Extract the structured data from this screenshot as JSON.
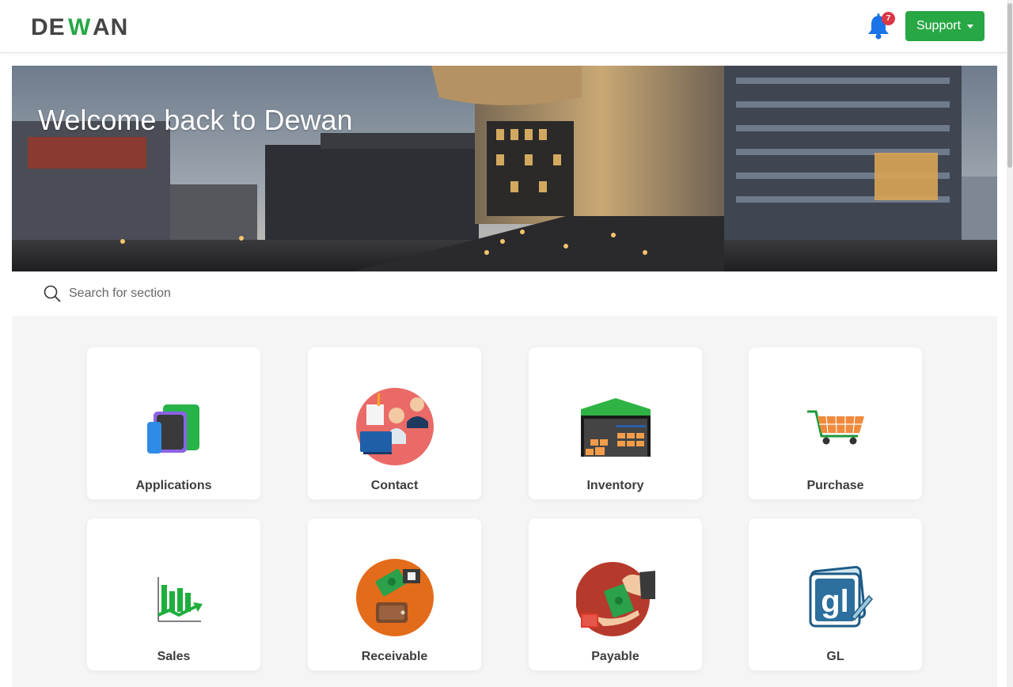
{
  "header": {
    "logo_text": "DEWAN",
    "notifications_count": "7",
    "support_label": "Support"
  },
  "hero": {
    "title": "Welcome back to Dewan"
  },
  "search": {
    "placeholder": "Search for section"
  },
  "sections": [
    {
      "label": "Applications",
      "icon": "applications-icon"
    },
    {
      "label": "Contact",
      "icon": "contact-icon"
    },
    {
      "label": "Inventory",
      "icon": "inventory-icon"
    },
    {
      "label": "Purchase",
      "icon": "purchase-icon"
    },
    {
      "label": "Sales",
      "icon": "sales-icon"
    },
    {
      "label": "Receivable",
      "icon": "receivable-icon"
    },
    {
      "label": "Payable",
      "icon": "payable-icon"
    },
    {
      "label": "GL",
      "icon": "gl-icon"
    }
  ],
  "colors": {
    "brand_green": "#28a745",
    "logo_dark": "#444444",
    "bell_blue": "#1a73e8",
    "badge_red": "#dc3545"
  }
}
